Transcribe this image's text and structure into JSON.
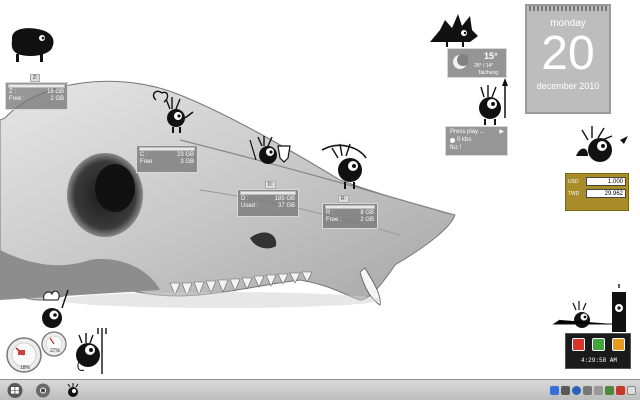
{
  "desktop": {
    "calendar": {
      "weekday": "monday",
      "day": "20",
      "month_year": "december 2010"
    },
    "weather": {
      "temp": "15°",
      "range": "28° / 14°",
      "city": "Taichung"
    },
    "media": {
      "line1": "Press play ...",
      "line2": "0 kbs",
      "line3": "fez !"
    },
    "drive_z": {
      "tag": "Z:",
      "label": "Z :",
      "size": "16 GB",
      "free_label": "Free :",
      "free": "2 GB"
    },
    "drive_c": {
      "tag": "C:",
      "label": "C :",
      "size": "23 GB",
      "free_label": "Free :",
      "free": "3 GB"
    },
    "drive_d": {
      "tag": "D:",
      "label": "D :",
      "size": "185 GB",
      "used_label": "Used :",
      "used": "37 GB"
    },
    "drive_r": {
      "tag": "R:",
      "label": "R :",
      "size": "8 GB",
      "free_label": "Free :",
      "free": "2 GB"
    },
    "currency": {
      "rows": [
        {
          "code": "USD",
          "value": "1.000"
        },
        {
          "code": "TWD",
          "value": "29.962"
        }
      ]
    },
    "gauges": {
      "cpu": "18%",
      "mem": "37%"
    },
    "clock": "4:29:58 AM",
    "colors": {
      "currency_bg": "#a88c2a",
      "power_red": "#d8342a",
      "power_green": "#3fa63a",
      "power_orange": "#e79a1c"
    }
  },
  "taskbar": {
    "start_icon": "windows-orb-icon",
    "pinned": [
      "chrome-icon",
      "mascot-icon"
    ],
    "tray_icons": [
      "network-icon",
      "volume-icon",
      "help-icon",
      "security-icon",
      "updates-icon",
      "app-tray-icon",
      "flag-icon",
      "chevron-icon"
    ]
  }
}
